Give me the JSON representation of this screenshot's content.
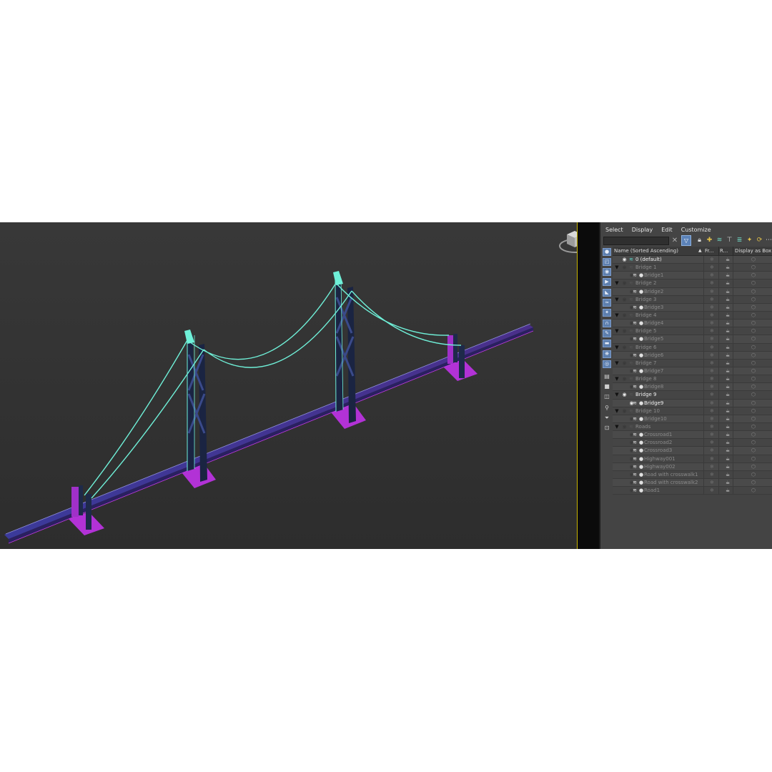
{
  "menu": [
    "Select",
    "Display",
    "Edit",
    "Customize"
  ],
  "search": {
    "value": "",
    "placeholder": ""
  },
  "columns": {
    "name": "Name (Sorted Ascending)",
    "sort_indicator": "▲",
    "frozen": "Fr...",
    "render": "R...",
    "display_box": "Display as Box"
  },
  "rows": [
    {
      "label": "0 (default)",
      "type": "layer",
      "level": 0,
      "expand": "",
      "visible": true,
      "active": true
    },
    {
      "label": "Bridge 1",
      "type": "layer",
      "level": 0,
      "expand": "▼",
      "visible": false
    },
    {
      "label": "Bridge1",
      "type": "object",
      "level": 1,
      "visible": false
    },
    {
      "label": "Bridge 2",
      "type": "layer",
      "level": 0,
      "expand": "▼",
      "visible": false
    },
    {
      "label": "Bridge2",
      "type": "object",
      "level": 1,
      "visible": false
    },
    {
      "label": "Bridge 3",
      "type": "layer",
      "level": 0,
      "expand": "▼",
      "visible": false
    },
    {
      "label": "Bridge3",
      "type": "object",
      "level": 1,
      "visible": false
    },
    {
      "label": "Bridge 4",
      "type": "layer",
      "level": 0,
      "expand": "▼",
      "visible": false
    },
    {
      "label": "Bridge4",
      "type": "object",
      "level": 1,
      "visible": false
    },
    {
      "label": "Bridge 5",
      "type": "layer",
      "level": 0,
      "expand": "▼",
      "visible": false
    },
    {
      "label": "Bridge5",
      "type": "object",
      "level": 1,
      "visible": false
    },
    {
      "label": "Bridge 6",
      "type": "layer",
      "level": 0,
      "expand": "▼",
      "visible": false
    },
    {
      "label": "Bridge6",
      "type": "object",
      "level": 1,
      "visible": false
    },
    {
      "label": "Bridge 7",
      "type": "layer",
      "level": 0,
      "expand": "▼",
      "visible": false
    },
    {
      "label": "Bridge7",
      "type": "object",
      "level": 1,
      "visible": false
    },
    {
      "label": "Bridge 8",
      "type": "layer",
      "level": 0,
      "expand": "▼",
      "visible": false
    },
    {
      "label": "Bridge8",
      "type": "object",
      "level": 1,
      "visible": false
    },
    {
      "label": "Bridge 9",
      "type": "layer",
      "level": 0,
      "expand": "▼",
      "visible": true
    },
    {
      "label": "Bridge9",
      "type": "object",
      "level": 1,
      "visible": true
    },
    {
      "label": "Bridge 10",
      "type": "layer",
      "level": 0,
      "expand": "▼",
      "visible": false
    },
    {
      "label": "Bridge10",
      "type": "object",
      "level": 1,
      "visible": false
    },
    {
      "label": "Roads",
      "type": "layer",
      "level": 0,
      "expand": "▼",
      "visible": false
    },
    {
      "label": "Crossroad1",
      "type": "object",
      "level": 1,
      "visible": false
    },
    {
      "label": "Crossroad2",
      "type": "object",
      "level": 1,
      "visible": false
    },
    {
      "label": "Crossroad3",
      "type": "object",
      "level": 1,
      "visible": false
    },
    {
      "label": "Highway001",
      "type": "object",
      "level": 1,
      "visible": false
    },
    {
      "label": "Highway002",
      "type": "object",
      "level": 1,
      "visible": false
    },
    {
      "label": "Road with crosswalk1",
      "type": "object",
      "level": 1,
      "visible": false
    },
    {
      "label": "Road with crosswalk2",
      "type": "object",
      "level": 1,
      "visible": false
    },
    {
      "label": "Road1",
      "type": "object",
      "level": 1,
      "visible": false
    }
  ],
  "colors": {
    "cable": "#6ff0d8",
    "tower": "#1e2a4a",
    "deck": "#3a2f7a",
    "magenta": "#c23ae0",
    "accent": "#5b82b8",
    "viewport_border": "#c8b400"
  },
  "icons": {
    "viewcube": "viewcube-icon",
    "eye": "eye-icon",
    "layer": "layer-stack-icon",
    "object": "object-dot-icon",
    "frozen": "snowflake-icon",
    "render": "teapot-icon",
    "box": "box-icon"
  }
}
